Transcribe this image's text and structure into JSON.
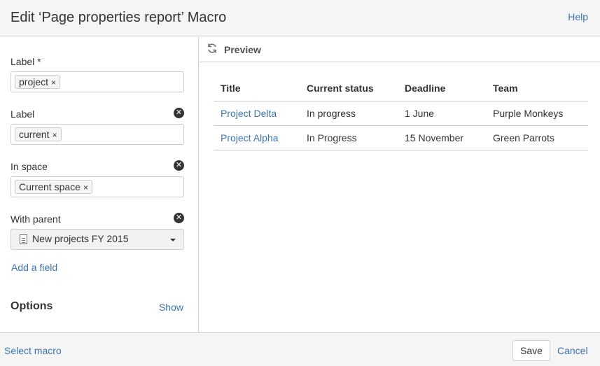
{
  "dialog": {
    "title": "Edit ‘Page properties report’ Macro",
    "help": "Help"
  },
  "sidebar": {
    "fields": [
      {
        "label": "Label *",
        "chips": [
          {
            "text": "project"
          }
        ],
        "removable": false
      },
      {
        "label": "Label",
        "chips": [
          {
            "text": "current"
          }
        ],
        "removable": true
      },
      {
        "label": "In space",
        "chips": [
          {
            "text": "Current space"
          }
        ],
        "removable": true
      },
      {
        "label": "With parent",
        "value": "New projects FY 2015",
        "removable": true
      }
    ],
    "chip_remove_glyph": "×",
    "field_remove_glyph": "✕",
    "add_field": "Add a field",
    "options_heading": "Options",
    "options_toggle": "Show"
  },
  "preview": {
    "label": "Preview",
    "columns": [
      "Title",
      "Current status",
      "Deadline",
      "Team"
    ],
    "rows": [
      [
        "Project Delta",
        "In progress",
        "1 June",
        "Purple Monkeys"
      ],
      [
        "Project Alpha",
        "In Progress",
        "15 November",
        "Green Parrots"
      ]
    ]
  },
  "footer": {
    "select_macro": "Select macro",
    "save": "Save",
    "cancel": "Cancel"
  },
  "colors": {
    "link": "#3b73af",
    "text": "#333333",
    "border": "#cccccc",
    "panel_bg": "#f5f5f5"
  },
  "icons": {
    "refresh": "refresh-icon",
    "remove": "close-circle-icon",
    "page": "page-icon",
    "dropdown": "chevron-down-icon"
  }
}
